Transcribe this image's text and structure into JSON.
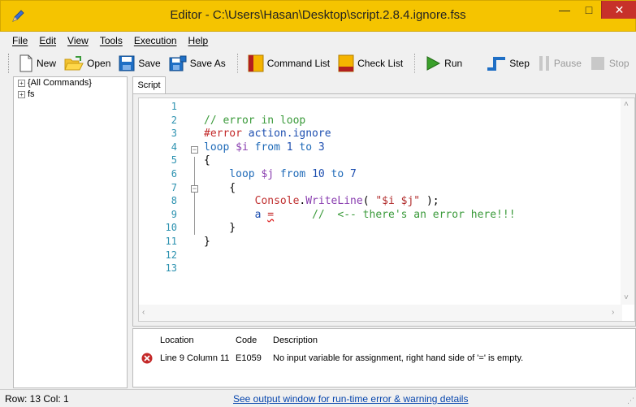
{
  "window": {
    "title": "Editor - C:\\Users\\Hasan\\Desktop\\script.2.8.4.ignore.fss",
    "minimize": "—",
    "maximize": "□",
    "close": "✕"
  },
  "menu": [
    {
      "label": "File"
    },
    {
      "label": "Edit"
    },
    {
      "label": "View"
    },
    {
      "label": "Tools"
    },
    {
      "label": "Execution"
    },
    {
      "label": "Help"
    }
  ],
  "toolbar": {
    "new": "New",
    "open": "Open",
    "save": "Save",
    "save_as": "Save As",
    "command_list": "Command List",
    "check_list": "Check List",
    "run": "Run",
    "step": "Step",
    "pause": "Pause",
    "stop": "Stop"
  },
  "tree": [
    {
      "label": "{All Commands}"
    },
    {
      "label": "fs"
    }
  ],
  "tab": {
    "label": "Script"
  },
  "editor": {
    "line_numbers": [
      "1",
      "2",
      "3",
      "4",
      "5",
      "6",
      "7",
      "8",
      "9",
      "10",
      "11",
      "12",
      "13"
    ],
    "lines": [
      [],
      [
        {
          "t": "// error in loop",
          "c": "c-comment"
        }
      ],
      [
        {
          "t": "#error",
          "c": "c-dir"
        },
        {
          "t": " action.ignore",
          "c": "c-id"
        }
      ],
      [
        {
          "t": "loop ",
          "c": "c-kw"
        },
        {
          "t": "$i",
          "c": "c-var"
        },
        {
          "t": " from ",
          "c": "c-kw"
        },
        {
          "t": "1",
          "c": "c-num"
        },
        {
          "t": " to ",
          "c": "c-kw"
        },
        {
          "t": "3",
          "c": "c-num"
        }
      ],
      [
        {
          "t": "{",
          "c": "c-plain"
        }
      ],
      [
        {
          "t": "    loop ",
          "c": "c-kw"
        },
        {
          "t": "$j",
          "c": "c-var"
        },
        {
          "t": " from ",
          "c": "c-kw"
        },
        {
          "t": "10",
          "c": "c-num"
        },
        {
          "t": " to ",
          "c": "c-kw"
        },
        {
          "t": "7",
          "c": "c-num"
        }
      ],
      [
        {
          "t": "    {",
          "c": "c-plain"
        }
      ],
      [
        {
          "t": "        Console",
          "c": "c-cls"
        },
        {
          "t": ".",
          "c": "c-plain"
        },
        {
          "t": "WriteLine",
          "c": "c-meth"
        },
        {
          "t": "( ",
          "c": "c-plain"
        },
        {
          "t": "\"$i $j\"",
          "c": "c-str"
        },
        {
          "t": " );",
          "c": "c-plain"
        }
      ],
      [
        {
          "t": "        a ",
          "c": "c-id"
        },
        {
          "t": "=",
          "c": "c-dir"
        },
        {
          "t": "      //  <-- there's an error here!!!",
          "c": "c-comment"
        }
      ],
      [
        {
          "t": "    }",
          "c": "c-plain"
        }
      ],
      [
        {
          "t": "}",
          "c": "c-plain"
        }
      ],
      [],
      []
    ]
  },
  "errors": {
    "headers": {
      "location": "Location",
      "code": "Code",
      "description": "Description"
    },
    "rows": [
      {
        "location": "Line 9 Column 11",
        "code": "E1059",
        "description": "No input variable for assignment, right hand side of '=' is empty."
      }
    ]
  },
  "status": {
    "position": "Row: 13  Col: 1",
    "link": "See output window for run-time error & warning details"
  },
  "colors": {
    "titlebar": "#f5c400",
    "close": "#c7312a",
    "link": "#0645ad"
  }
}
